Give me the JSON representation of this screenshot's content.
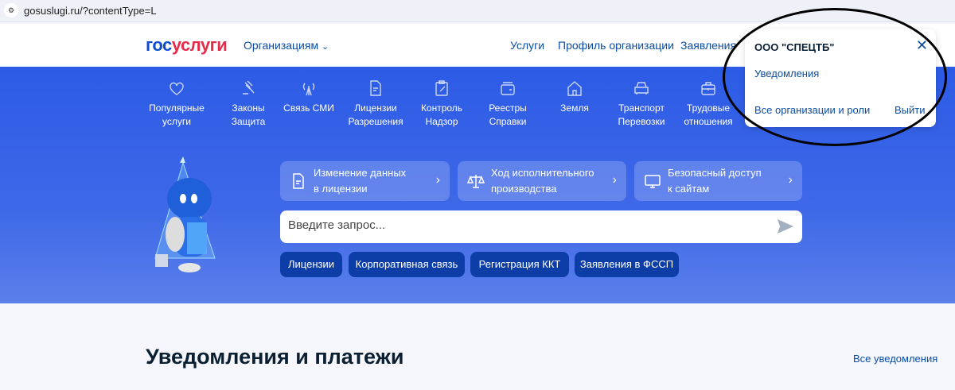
{
  "browser": {
    "url": "gosuslugi.ru/?contentType=L"
  },
  "header": {
    "logo_a": "гос",
    "logo_b": "услуги",
    "orgs_menu": "Организациям",
    "nav": [
      "Услуги",
      "Профиль организации",
      "Заявления"
    ]
  },
  "categories": [
    {
      "l1": "Популярные",
      "l2": "услуги",
      "icon": "heart-icon"
    },
    {
      "l1": "Законы",
      "l2": "Защита",
      "icon": "gavel-icon"
    },
    {
      "l1": "Связь СМИ",
      "l2": "",
      "icon": "antenna-icon"
    },
    {
      "l1": "Лицензии",
      "l2": "Разрешения",
      "icon": "document-icon"
    },
    {
      "l1": "Контроль",
      "l2": "Надзор",
      "icon": "clipboard-icon"
    },
    {
      "l1": "Реестры",
      "l2": "Справки",
      "icon": "wallet-icon"
    },
    {
      "l1": "Земля",
      "l2": "",
      "icon": "house-icon"
    },
    {
      "l1": "Транспорт",
      "l2": "Перевозки",
      "icon": "car-icon"
    },
    {
      "l1": "Трудовые",
      "l2": "отношения",
      "icon": "briefcase-icon"
    }
  ],
  "cards": [
    {
      "l1": "Изменение данных",
      "l2": "в лицензии"
    },
    {
      "l1": "Ход исполнительного",
      "l2": "производства"
    },
    {
      "l1": "Безопасный доступ",
      "l2": "к сайтам"
    }
  ],
  "search": {
    "placeholder": "Введите запрос..."
  },
  "chips": [
    "Лицензии",
    "Корпоративная связь",
    "Регистрация ККТ",
    "Заявления в ФССП"
  ],
  "section": {
    "title": "Уведомления и платежи",
    "link": "Все уведомления"
  },
  "popup": {
    "org": "ООО \"СПЕЦТБ\"",
    "notifications": "Уведомления",
    "all_orgs": "Все организации и роли",
    "exit": "Выйти"
  }
}
